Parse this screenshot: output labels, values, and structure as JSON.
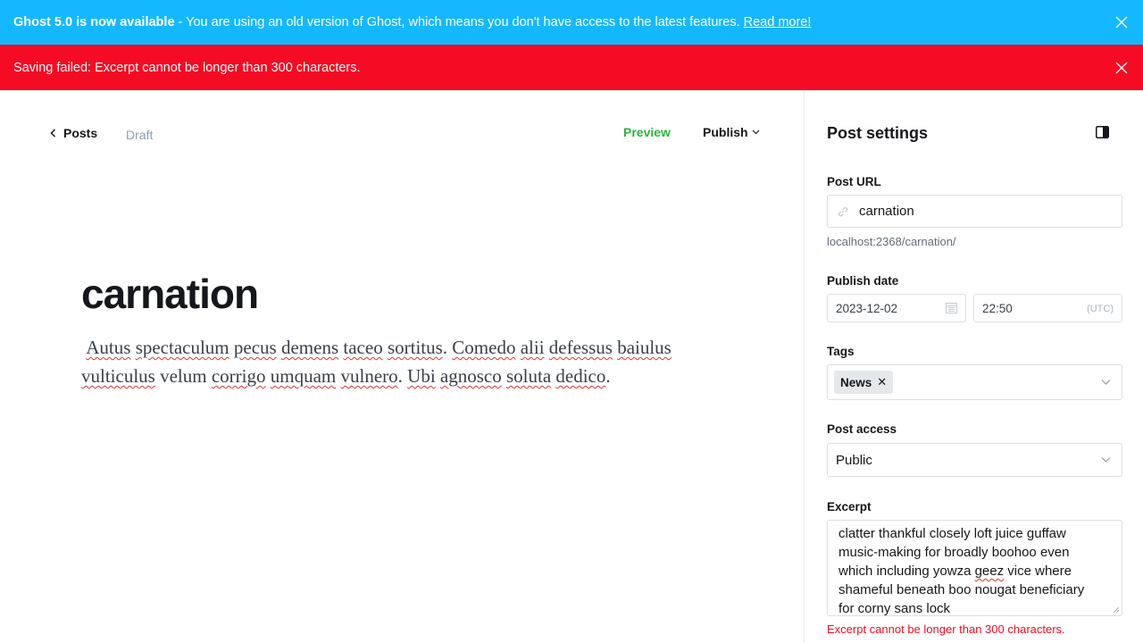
{
  "banners": {
    "upgrade": {
      "bold": "Ghost 5.0 is now available",
      "text": " - You are using an old version of Ghost, which means you don't have access to the latest features. ",
      "link": "Read more!"
    },
    "error": {
      "text": "Saving failed: Excerpt cannot be longer than 300 characters."
    }
  },
  "editor": {
    "back_label": "Posts",
    "status": "Draft",
    "preview_label": "Preview",
    "publish_label": "Publish",
    "title": "carnation",
    "body": {
      "w1": "Autus",
      "w2": "spectaculum",
      "w3": "pecus",
      "w4": "demens",
      "w5": "taceo",
      "w6": "sortitus",
      "p1": ". ",
      "w7": "Comedo",
      "w8": "alii",
      "w9": "defessus",
      "w10": "baiulus",
      "w11": "vulticulus",
      "w12": " velum ",
      "w13": "corrigo",
      "w14": "umquam",
      "w15": "vulnero",
      "p2": ". ",
      "w16": "Ubi",
      "w17": "agnosco",
      "w18": "soluta",
      "w19": "dedico",
      "p3": "."
    }
  },
  "sidebar": {
    "title": "Post settings",
    "post_url": {
      "label": "Post URL",
      "value": "carnation",
      "hint": "localhost:2368/carnation/"
    },
    "publish_date": {
      "label": "Publish date",
      "date": "2023-12-02",
      "time": "22:50",
      "tz": "(UTC)"
    },
    "tags": {
      "label": "Tags",
      "items": [
        {
          "label": "News"
        }
      ]
    },
    "access": {
      "label": "Post access",
      "value": "Public"
    },
    "excerpt": {
      "label": "Excerpt",
      "l1": "clatter thankful closely loft juice guffaw",
      "l2": "music-making for broadly boohoo even",
      "l3a": "which including yowza ",
      "l3b": "geez",
      "l3c": " vice where",
      "l4": "shameful beneath boo nougat beneficiary",
      "l5": "for corny sans lock",
      "error": "Excerpt cannot be longer than 300 characters."
    }
  },
  "colors": {
    "upgrade_banner": "#14b8ff",
    "error_banner": "#f50b23",
    "preview": "#2bb53b",
    "error_text": "#f50b23"
  }
}
